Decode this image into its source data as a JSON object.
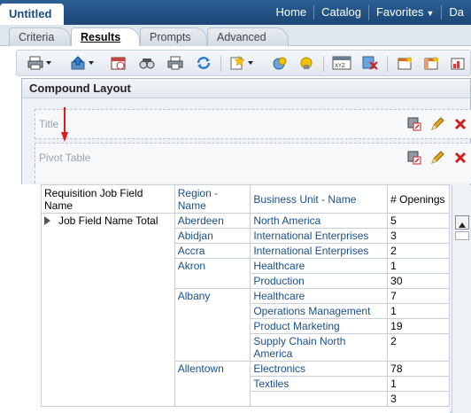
{
  "app": {
    "title": "Untitled"
  },
  "nav": {
    "home": "Home",
    "catalog": "Catalog",
    "favorites": "Favorites",
    "dashboards": "Da"
  },
  "tabs": [
    "Criteria",
    "Results",
    "Prompts",
    "Advanced"
  ],
  "active_tab": "Results",
  "compound": {
    "title": "Compound Layout"
  },
  "views": {
    "title_label": "Title",
    "pivot_label": "Pivot Table"
  },
  "pivot": {
    "columns": [
      "Requisition Job Field Name",
      "Region - Name",
      "Business Unit - Name",
      "# Openings"
    ],
    "row_header": "Job Field Name Total",
    "rows": [
      {
        "region": "Aberdeen",
        "unit": "North America",
        "openings": "5"
      },
      {
        "region": "Abidjan",
        "unit": "International Enterprises",
        "openings": "3"
      },
      {
        "region": "Accra",
        "unit": "International Enterprises",
        "openings": "2"
      },
      {
        "region": "Akron",
        "unit": "Healthcare",
        "openings": "1"
      },
      {
        "region": "",
        "unit": "Production",
        "openings": "30"
      },
      {
        "region": "Albany",
        "unit": "Healthcare",
        "openings": "7"
      },
      {
        "region": "",
        "unit": "Operations Management",
        "openings": "1"
      },
      {
        "region": "",
        "unit": "Product Marketing",
        "openings": "19"
      },
      {
        "region": "",
        "unit": "Supply Chain North America",
        "openings": "2"
      },
      {
        "region": "Allentown",
        "unit": "Electronics",
        "openings": "78"
      },
      {
        "region": "",
        "unit": "Textiles",
        "openings": "1"
      },
      {
        "region": "",
        "unit": "",
        "openings": "3"
      }
    ]
  },
  "colors": {
    "accent": "#1c4675",
    "link": "#1a4f8a",
    "delete": "#d41f1f"
  }
}
